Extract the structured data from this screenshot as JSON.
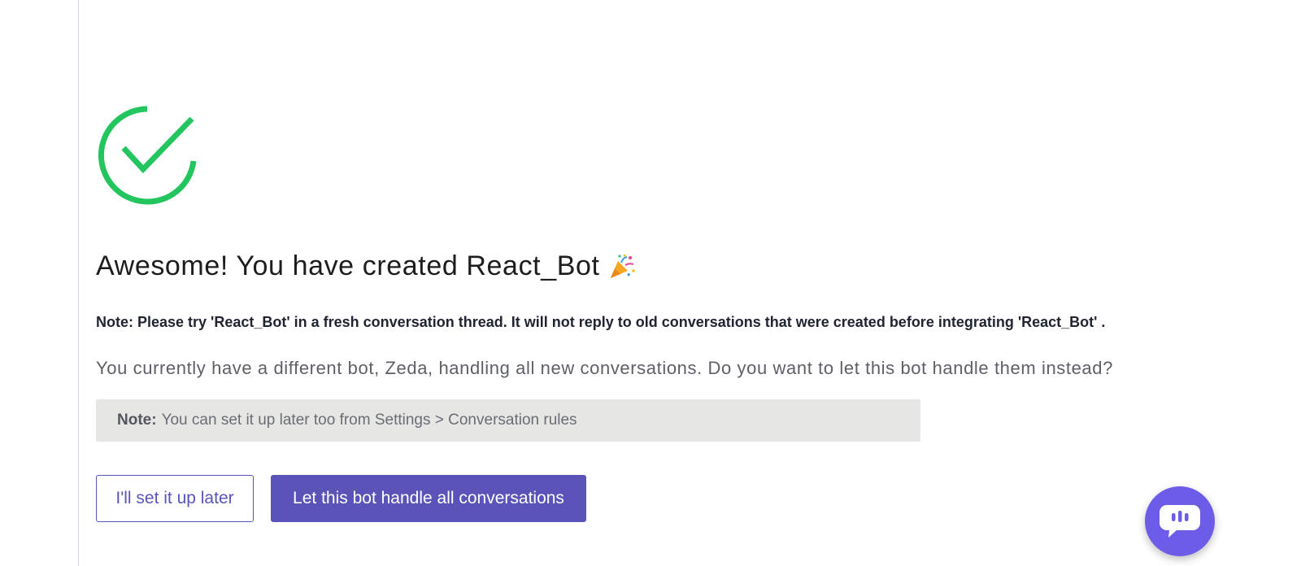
{
  "success": {
    "title": "Awesome! You have created React_Bot",
    "title_icon": "party-popper-icon",
    "check_icon": "check-circle-icon",
    "accent_color": "#22c55e"
  },
  "note": {
    "text": "Note: Please try 'React_Bot' in a fresh conversation thread. It will not reply to old conversations that were created before integrating 'React_Bot' ."
  },
  "question": {
    "text": "You currently have a different bot, Zeda, handling all new conversations. Do you want to let this bot handle them instead?"
  },
  "info_box": {
    "label": "Note:",
    "text": "You can set it up later too from Settings > Conversation rules"
  },
  "actions": {
    "later_label": "I'll set it up later",
    "primary_label": "Let this bot handle all conversations",
    "brand_color": "#5a54b9"
  },
  "chat_widget": {
    "icon": "chat-bubble-icon",
    "color": "#6c5ce7"
  }
}
